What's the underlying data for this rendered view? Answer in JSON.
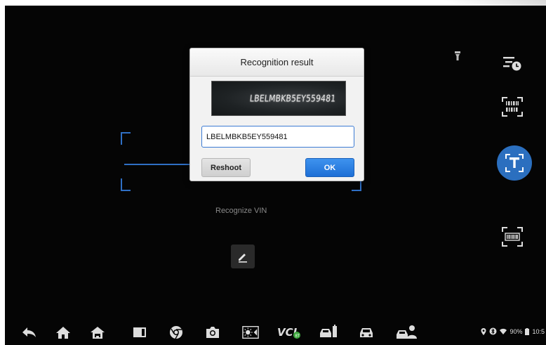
{
  "dialog": {
    "title": "Recognition result",
    "vin_image_text": "LBELMBKB5EY559481",
    "vin_value": "LBELMBKB5EY559481",
    "reshoot_label": "Reshoot",
    "ok_label": "OK"
  },
  "scanner": {
    "recognize_label": "Recognize VIN"
  },
  "status_bar": {
    "battery": "90%",
    "time": "10:5"
  },
  "colors": {
    "accent": "#2b6fbf",
    "ok_button": "#1e6fd6",
    "background": "#050505"
  },
  "icons": {
    "rail": [
      "history-icon",
      "barcode-scan-icon",
      "text-recognition-icon",
      "vin-scan-icon"
    ],
    "nav": [
      "back-icon",
      "home-icon",
      "vehicle-home-icon",
      "window-icon",
      "browser-icon",
      "camera-icon",
      "brightness-icon",
      "vci-icon",
      "vehicle-diagnostics-icon",
      "car-icon",
      "service-car-icon"
    ]
  }
}
